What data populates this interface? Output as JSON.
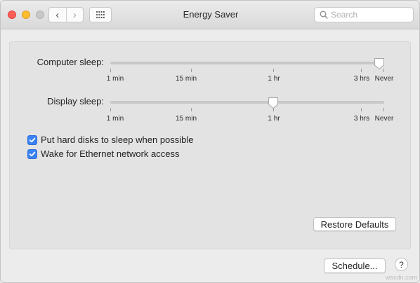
{
  "window": {
    "title": "Energy Saver"
  },
  "search": {
    "placeholder": "Search"
  },
  "computer_sleep": {
    "label": "Computer sleep:",
    "value": "Never",
    "ticks": [
      "1 min",
      "15 min",
      "1 hr",
      "3 hrs",
      "Never"
    ]
  },
  "display_sleep": {
    "label": "Display sleep:",
    "value": "1 hr",
    "ticks": [
      "1 min",
      "15 min",
      "1 hr",
      "3 hrs",
      "Never"
    ]
  },
  "options": [
    {
      "label": "Put hard disks to sleep when possible",
      "checked": true
    },
    {
      "label": "Wake for Ethernet network access",
      "checked": true
    }
  ],
  "buttons": {
    "restore_defaults": "Restore Defaults",
    "schedule": "Schedule...",
    "help": "?"
  },
  "watermark": "wsxdn.com",
  "colors": {
    "accent": "#3b82f6",
    "close": "#fd5f57",
    "minimize": "#febc2e",
    "zoom": "#c8c8c8"
  }
}
